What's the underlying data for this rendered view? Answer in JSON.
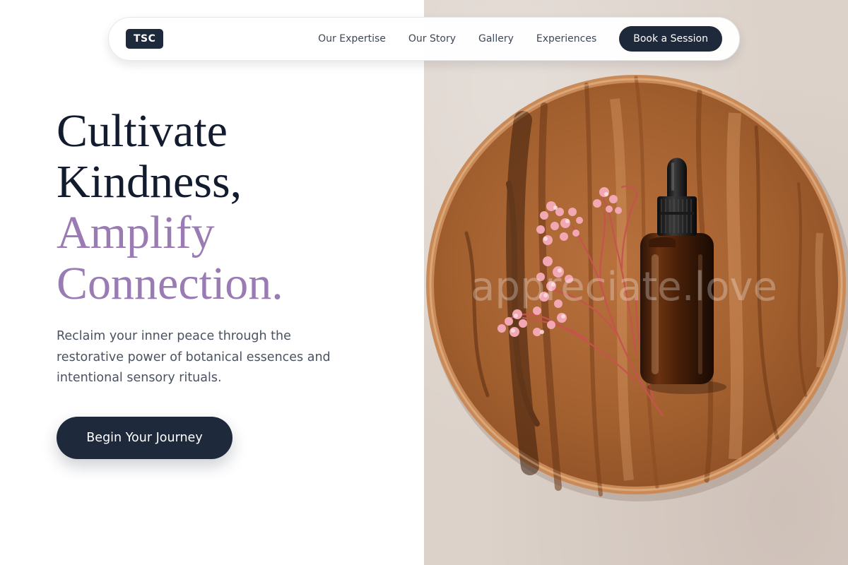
{
  "nav": {
    "logo": "TSC",
    "links": [
      "Our Expertise",
      "Our Story",
      "Gallery",
      "Experiences"
    ],
    "cta": "Book a Session"
  },
  "hero": {
    "headline_line1": "Cultivate",
    "headline_line2": "Kindness,",
    "headline_line3": "Amplify",
    "headline_line4": "Connection.",
    "subtext": "Reclaim your inner peace through the restorative power of botanical essences and intentional sensory rituals.",
    "cta": "Begin Your Journey"
  },
  "image": {
    "watermark": "appreciate.love"
  },
  "colors": {
    "primary": "#1e293b",
    "accent": "#9a7bb3",
    "heading": "#131c2e",
    "body_text": "#4a5262"
  }
}
